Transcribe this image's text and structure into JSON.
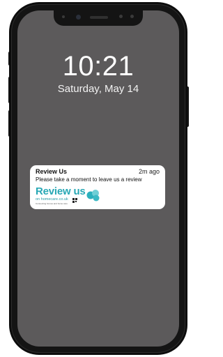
{
  "lockscreen": {
    "time": "10:21",
    "date": "Saturday, May 14"
  },
  "notification": {
    "app_name": "Review Us",
    "time_ago": "2m ago",
    "message": "Please take a moment to leave us a review",
    "logo": {
      "title": "Review us",
      "subtitle": "on homecare.co.uk",
      "tagline": "Connecting homes and home care"
    }
  },
  "colors": {
    "screen_bg": "#5c5a5b",
    "brand_teal": "#28a8b5",
    "phone_frame": "#141414",
    "card_bg": "#ffffff"
  },
  "icons": [
    "camera-icon",
    "qr-code-icon",
    "speech-bubbles-icon"
  ]
}
